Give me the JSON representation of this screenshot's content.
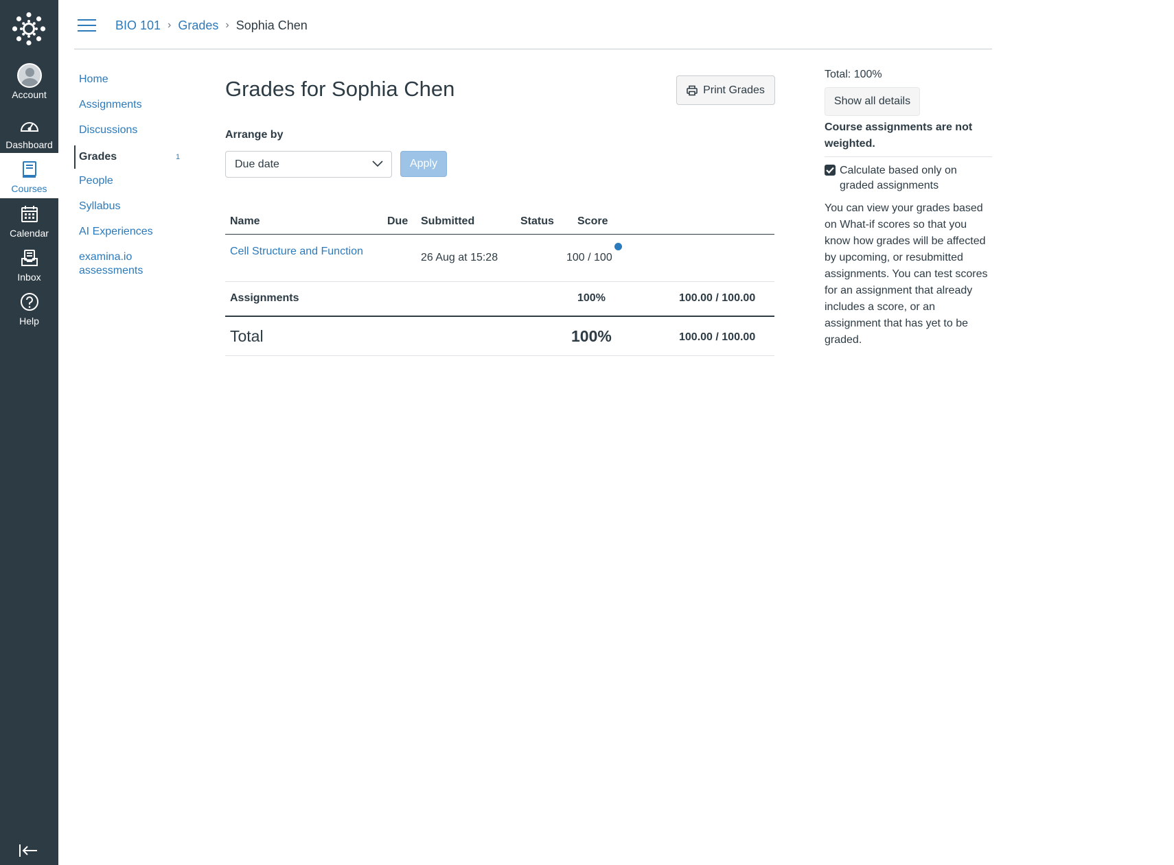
{
  "global_nav": {
    "items": [
      {
        "label": "Account",
        "icon": "avatar-icon"
      },
      {
        "label": "Dashboard",
        "icon": "dashboard-gauge-icon"
      },
      {
        "label": "Courses",
        "icon": "book-icon",
        "active": true
      },
      {
        "label": "Calendar",
        "icon": "calendar-icon"
      },
      {
        "label": "Inbox",
        "icon": "inbox-icon"
      },
      {
        "label": "Help",
        "icon": "help-circle-icon"
      }
    ],
    "collapse_icon": "collapse-arrow-icon"
  },
  "header": {
    "menu_icon": "hamburger-icon",
    "breadcrumbs": [
      "BIO 101",
      "Grades",
      "Sophia Chen"
    ]
  },
  "course_nav": {
    "items": [
      {
        "label": "Home"
      },
      {
        "label": "Assignments"
      },
      {
        "label": "Discussions"
      },
      {
        "label": "Grades",
        "active": true,
        "badge": "1"
      },
      {
        "label": "People"
      },
      {
        "label": "Syllabus"
      },
      {
        "label": "AI Experiences"
      },
      {
        "label": "examina.io assessments"
      }
    ]
  },
  "main": {
    "title": "Grades for Sophia Chen",
    "print_button": "Print Grades",
    "arrange_label": "Arrange by",
    "arrange_selected": "Due date",
    "apply_button": "Apply",
    "table": {
      "headers": [
        "Name",
        "Due",
        "Submitted",
        "Status",
        "Score"
      ],
      "rows": [
        {
          "name": "Cell Structure and Function",
          "due": "",
          "submitted": "26 Aug at 15:28",
          "status": "",
          "score": "100 / 100",
          "unread": true
        }
      ],
      "group_row": {
        "name": "Assignments",
        "percent": "100%",
        "points": "100.00 / 100.00"
      },
      "total_row": {
        "name": "Total",
        "percent": "100%",
        "points": "100.00 / 100.00"
      }
    }
  },
  "sidebar": {
    "total": "Total: 100%",
    "show_details_button": "Show all details",
    "weight_note": "Course assignments are not weighted.",
    "calc_checkbox_label": "Calculate based only on graded assignments",
    "calc_checked": true,
    "whatif_note": "You can view your grades based on What-if scores so that you know how grades will be affected by upcoming, or resubmitted assignments. You can test scores for an assignment that already includes a score, or an assignment that has yet to be graded."
  },
  "colors": {
    "nav_bg": "#2d3b45",
    "link": "#2b7abc",
    "apply_disabled": "#9dc3e6"
  }
}
